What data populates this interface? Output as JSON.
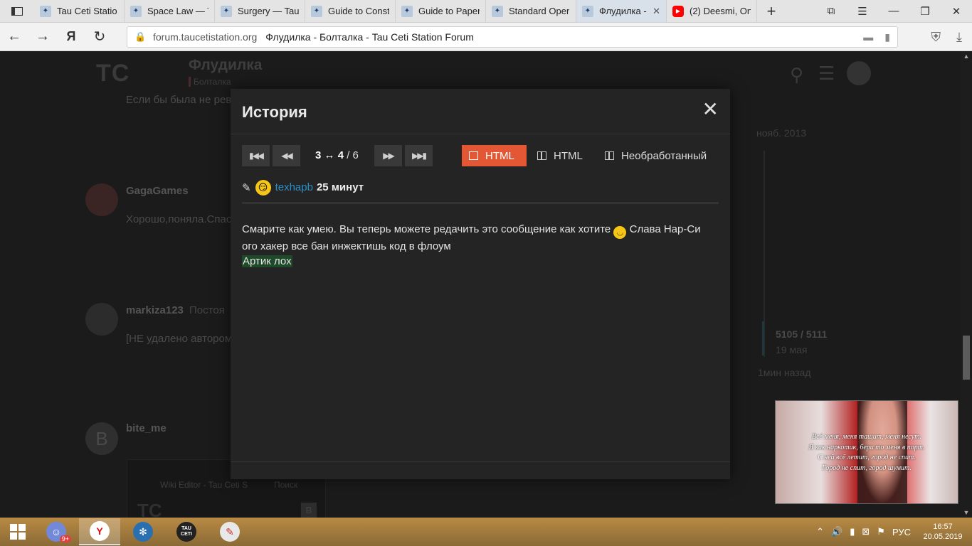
{
  "browser": {
    "tabs": [
      {
        "title": "Tau Ceti Statio",
        "icon": "tauceti-favicon"
      },
      {
        "title": "Space Law — T",
        "icon": "tauceti-favicon"
      },
      {
        "title": "Surgery — Tau",
        "icon": "tauceti-favicon"
      },
      {
        "title": "Guide to Const",
        "icon": "tauceti-favicon"
      },
      {
        "title": "Guide to Paper",
        "icon": "tauceti-favicon"
      },
      {
        "title": "Standard Oper",
        "icon": "tauceti-favicon"
      },
      {
        "title": "Флудилка -",
        "icon": "tauceti-favicon",
        "active": true
      },
      {
        "title": "(2) Deesmi, On",
        "icon": "youtube-favicon"
      }
    ],
    "address": {
      "host": "forum.taucetistation.org",
      "page_title": "Флудилка - Болталка - Tau Ceti Station Forum"
    },
    "yandex_button": "Я"
  },
  "forum_bg": {
    "logo": "TC",
    "category": "Флудилка",
    "subcategory": "Болталка",
    "post1_text": "Если бы была не рев",
    "user2": "GagaGames",
    "post2_text": "Хорошо,поняла.Спас",
    "user3": "markiza123",
    "user3_suffix": "Постоя",
    "post3_text": "[НЕ удалено автором",
    "user4": "bite_me",
    "avatar4_letter": "B",
    "timeline_date": "нояб. 2013",
    "timeline_count": "5105 / 5111",
    "timeline_date2": "19 мая",
    "timeline_ago": "1мин назад",
    "mini_tab": "Wiki Editor - Tau Ceti S",
    "mini_search": "Поиск",
    "mini_logo": "TC",
    "mini_avatar": "B"
  },
  "modal": {
    "title": "История",
    "close_label": "✕",
    "revision": {
      "current": "3",
      "arrow": "↔",
      "target": "4",
      "total": "6"
    },
    "modes": [
      {
        "label": "HTML",
        "active": true
      },
      {
        "label": "HTML",
        "active": false
      },
      {
        "label": "Необработанный",
        "active": false
      }
    ],
    "author": "texhapb",
    "time_ago": "25 минут",
    "body_line1": "Смарите как умею. Вы теперь можете редачить это сообщение как хотите",
    "body_line1_tail": "Слава Нар-Си",
    "body_line2": "ого хакер все бан инжектишь код в флоум",
    "body_inserted": "Артик лох"
  },
  "video_overlay": {
    "lyrics": [
      "Всё меня, меня тащит, меня несут.",
      "Я как наркотик, бери то меня в порт.",
      "С ней всё летит, город не спит.",
      "Город не спит, город шумит."
    ]
  },
  "taskbar": {
    "discord_badge": "9+",
    "yandex_label": "Y",
    "tauceti_label": "TAU CETI",
    "lang": "РУС",
    "time": "16:57",
    "date": "20.05.2019"
  },
  "colors": {
    "accent": "#e45735",
    "link": "#2a8fc7",
    "insert_bg": "#1f4a2a"
  }
}
